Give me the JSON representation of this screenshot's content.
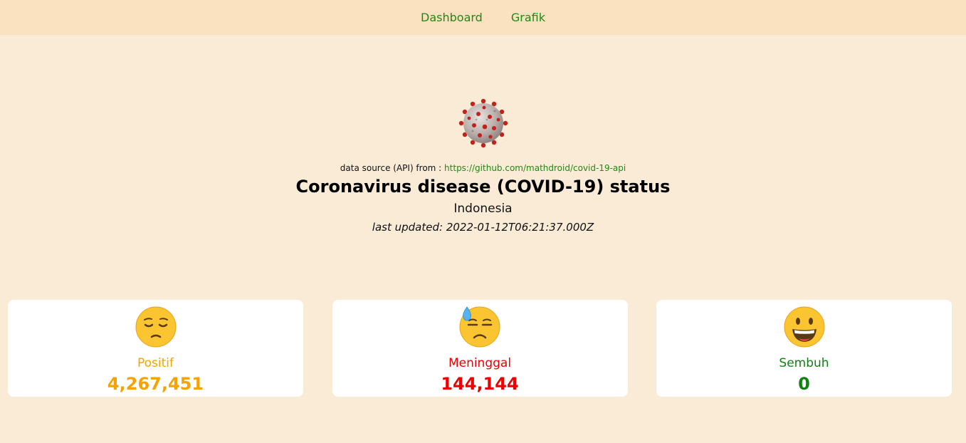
{
  "nav": {
    "items": [
      {
        "label": "Dashboard"
      },
      {
        "label": "Grafik"
      }
    ],
    "link_color": "#1f8a12",
    "background": "#fae1bf"
  },
  "header": {
    "logo_icon": "coronavirus-icon",
    "source_prefix": "data source (API) from :",
    "source_link": "https://github.com/mathdroid/covid-19-api",
    "title": "Coronavirus disease (COVID-19) status",
    "country": "Indonesia",
    "last_updated": "last updated: 2022-01-12T06:21:37.000Z"
  },
  "cards": [
    {
      "icon": "pensive-face-icon",
      "label": "Positif",
      "value": "4,267,451",
      "color": "#f5a300"
    },
    {
      "icon": "downcast-face-with-sweat-icon",
      "label": "Meninggal",
      "value": "144,144",
      "color": "#ee0000"
    },
    {
      "icon": "grinning-face-icon",
      "label": "Sembuh",
      "value": "0",
      "color": "#128012"
    }
  ],
  "colors": {
    "page_background": "#faebd7",
    "card_background": "#ffffff"
  }
}
